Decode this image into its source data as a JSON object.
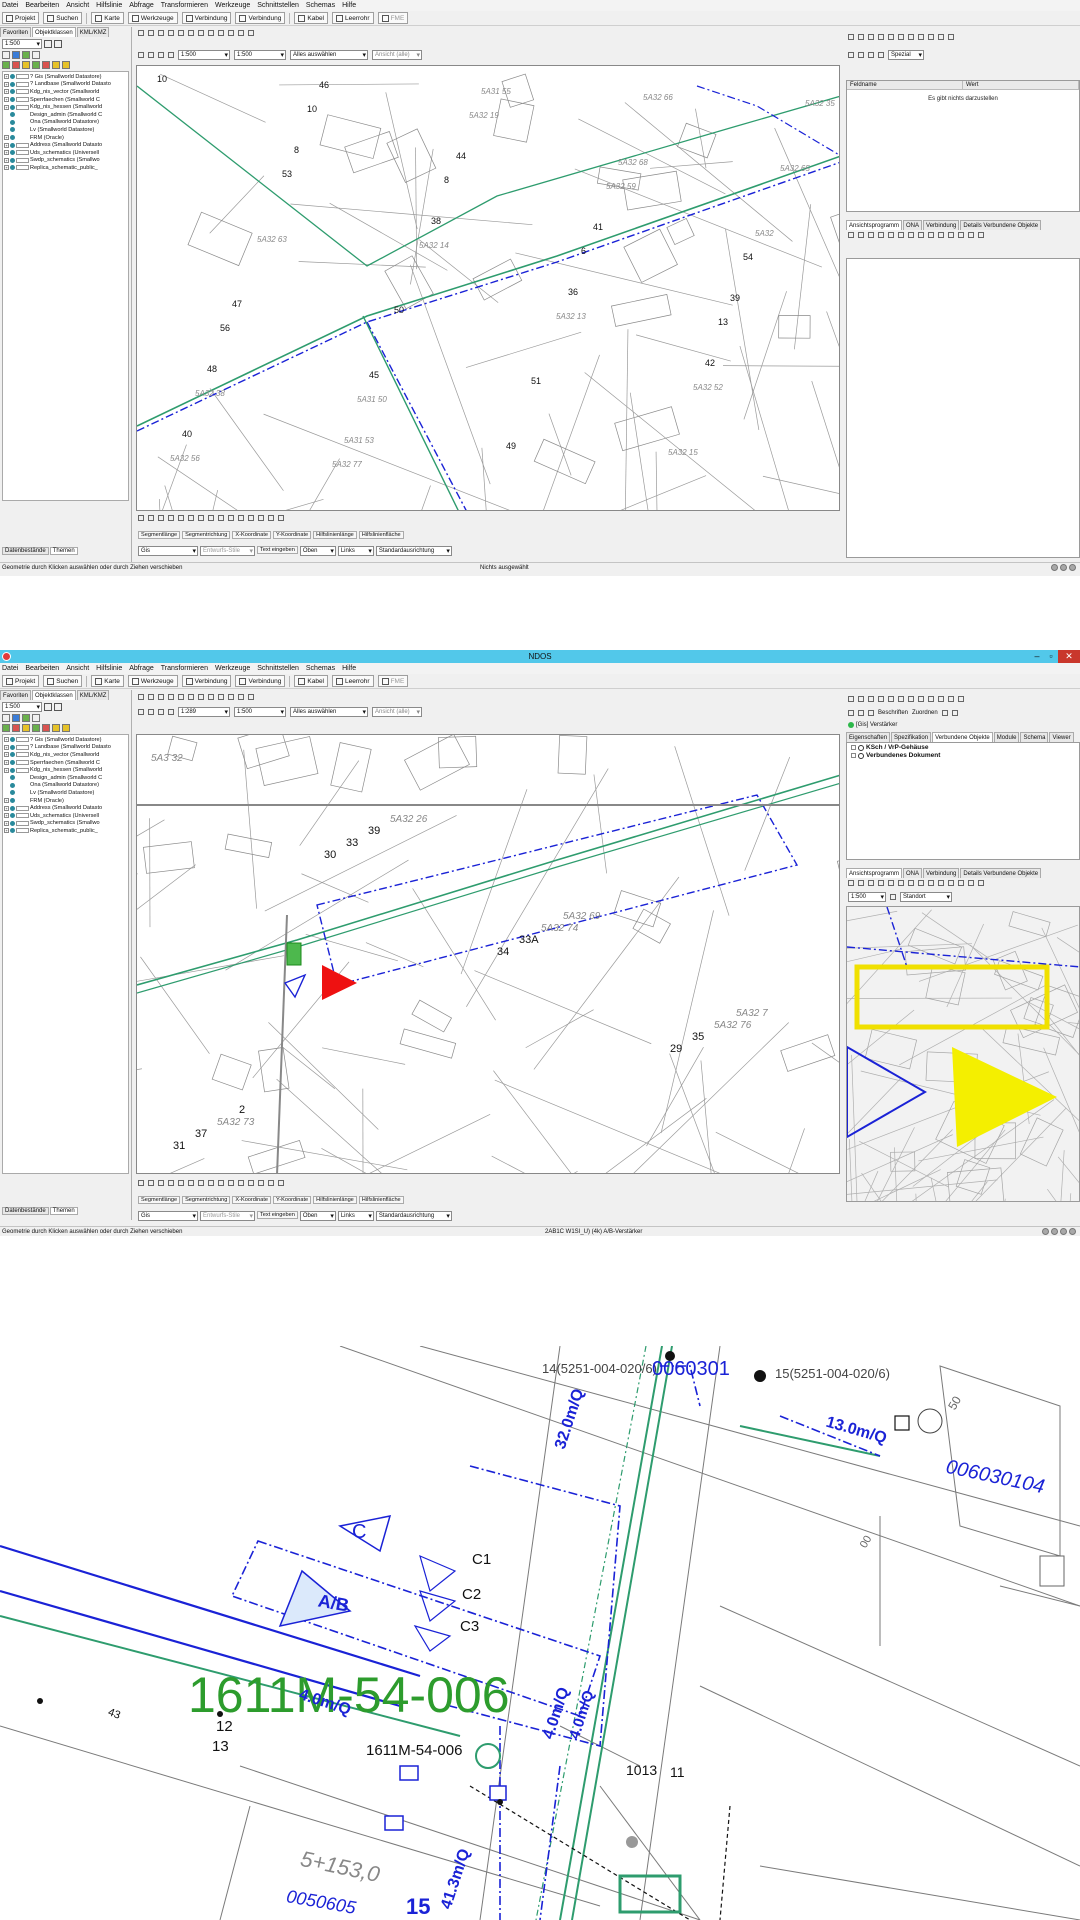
{
  "win1": {
    "menu": [
      "Datei",
      "Bearbeiten",
      "Ansicht",
      "Hilfslinie",
      "Abfrage",
      "Transformieren",
      "Werkzeuge",
      "Schnittstellen",
      "Schemas",
      "Hilfe"
    ],
    "toolbar": [
      "Projekt",
      "Suchen",
      "Karte",
      "Werkzeuge",
      "Verbindung",
      "Verbindung",
      "Kabel",
      "Leerrohr",
      "FME"
    ],
    "left_tabs": [
      "Favoriten",
      "Objektklassen",
      "KML/KMZ"
    ],
    "scale": "1:500",
    "datasets": [
      "? Gis (Smallworld Datastore)",
      "? Landbase (Smallworld Datasto",
      "Kdg_nis_vector (Smallworld",
      "Sperrfaechen (Smallworld C",
      "Kdg_nis_hessen (Smallworld",
      "Design_admin (Smallworld C",
      "Ona (Smallworld Datastore)",
      "Lv (Smallworld Datastore)",
      "FRM (Oracle)",
      "Address (Smallworld Datasto",
      "Uds_schematics (Universell",
      "Swdp_schematics (Smallwo",
      "Replica_schematic_public_"
    ],
    "bottom_tabs": [
      "Datenbestände",
      "Themen"
    ],
    "map_toolbar": {
      "scale_a": "1:500",
      "scale_b": "1:500",
      "select_all": "Alles auswählen",
      "view_all": "Ansicht (alle)"
    },
    "map_labels": [
      "10",
      "8",
      "38",
      "36",
      "42",
      "40",
      "46",
      "44",
      "41",
      "39",
      "48",
      "5A31 53",
      "5A31 55",
      "5A32 68",
      "5A32",
      "47",
      "45",
      "49",
      "5A32 66",
      "5A32 65",
      "5A32 63",
      "50",
      "51",
      "5A32 15",
      "5A32 35",
      "53",
      "5A32 14",
      "5A32 13",
      "5A32 52",
      "5A32 56",
      "10",
      "8",
      "6",
      "13",
      "5A32 38",
      "5A32 77",
      "5A32 19",
      "5A32 59",
      "54",
      "56",
      "5A31 50"
    ],
    "segment_fields": [
      "Segmentlänge",
      "Segmentrichtung",
      "X-Koordinate",
      "Y-Koordinate",
      "Hilfslinienlänge",
      "Hilfslinienfläche"
    ],
    "bottom_fields": {
      "layer": "Gis",
      "style": "Entwurfs-Stile",
      "text": "Text eingeben",
      "top": "Oben",
      "left": "Links",
      "orientation": "Standardausrichtung"
    },
    "right_header": {
      "name": "Feldname",
      "value": "Wert"
    },
    "right_empty": "Es gibt nichts darzustellen",
    "right_tabs": [
      "Ansichtsprogramm",
      "ONA",
      "Verbindung",
      "Details Verbundene Objekte"
    ],
    "right_toolbar": [
      "Spezial"
    ],
    "status_left": "Geometrie durch Klicken auswählen oder durch Ziehen verschieben",
    "status_mid": "Nichts ausgewählt"
  },
  "win2": {
    "title": "NDOS",
    "menu": [
      "Datei",
      "Bearbeiten",
      "Ansicht",
      "Hilfslinie",
      "Abfrage",
      "Transformieren",
      "Werkzeuge",
      "Schnittstellen",
      "Schemas",
      "Hilfe"
    ],
    "toolbar": [
      "Projekt",
      "Suchen",
      "Karte",
      "Werkzeuge",
      "Verbindung",
      "Verbindung",
      "Kabel",
      "Leerrohr",
      "FME"
    ],
    "left_tabs": [
      "Favoriten",
      "Objektklassen",
      "KML/KMZ"
    ],
    "scale": "1:500",
    "datasets": [
      "? Gis (Smallworld Datastore)",
      "? Landbase (Smallworld Datasto",
      "Kdg_nis_vector (Smallworld",
      "Sperrfaechen (Smallworld C",
      "Kdg_nis_hessen (Smallworld",
      "Design_admin (Smallworld C",
      "Ona (Smallworld Datastore)",
      "Lv (Smallworld Datastore)",
      "FRM (Oracle)",
      "Address (Smallworld Datasto",
      "Uds_schematics (Universell",
      "Swdp_schematics (Smallwo",
      "Replica_schematic_public_"
    ],
    "bottom_tabs": [
      "Datenbestände",
      "Themen"
    ],
    "map_toolbar": {
      "scale_a": "1:289",
      "scale_b": "1:500",
      "select_all": "Alles auswählen",
      "view_all": "Ansicht (alle)"
    },
    "map_labels": [
      "5A3 32",
      "30",
      "34",
      "29",
      "31",
      "33",
      "33A",
      "35",
      "37",
      "39",
      "5A32 74",
      "5A32 76",
      "5A32 73",
      "5A32 26",
      "5A32 69",
      "5A32 7",
      "2"
    ],
    "segment_fields": [
      "Segmentlänge",
      "Segmentrichtung",
      "X-Koordinate",
      "Y-Koordinate",
      "Hilfslinienlänge",
      "Hilfslinienfläche"
    ],
    "bottom_fields": {
      "layer": "Gis",
      "style": "Entwurfs-Stile",
      "text": "Text eingeben",
      "top": "Oben",
      "left": "Links",
      "orientation": "Standardausrichtung"
    },
    "right_object": "[Gis] Verstärker",
    "right_toolbar": {
      "label": "Beschriften",
      "assign": "Zuordnen"
    },
    "right_tabs_top": [
      "Eigenschaften",
      "Spezifikation",
      "Verbundene Objekte",
      "Module",
      "Schema",
      "Viewer"
    ],
    "right_tree": [
      "KSch / VrP-Gehäuse",
      "Verbundenes Dokument"
    ],
    "right_tabs": [
      "Ansichtsprogramm",
      "ONA",
      "Verbindung",
      "Details Verbundene Objekte"
    ],
    "overview": {
      "scale": "1:500",
      "mode": "Standort"
    },
    "status_left": "Geometrie durch Klicken auswählen oder durch Ziehen verschieben",
    "status_mid": "2AB1C W1SI_U) (4k) A/B-Verstärker"
  },
  "zoom": {
    "labels": {
      "addr1": "14(5251-004-020/6)",
      "code1": "0060301",
      "addr2": "15(5251-004-020/6)",
      "len1": "13.0m/Q",
      "code2": "006030104",
      "len2": "32.0m/Q",
      "c_label": "C",
      "c1": "C1",
      "c2": "C2",
      "c3": "C3",
      "ab": "A/B",
      "big_id": "1611M-54-006",
      "small_id": "1611M-54-006",
      "len3": "4.0m/Q",
      "len4": "4.0m/Q",
      "len5": "4.0m/Q",
      "len6": "41.3m/Q",
      "n12": "12",
      "n13": "13",
      "n43": "43",
      "n1013": "1013",
      "n11": "11",
      "parcel": "5+153,0",
      "code3": "0050605",
      "n15": "15",
      "n50": "50",
      "n00": "00"
    }
  }
}
